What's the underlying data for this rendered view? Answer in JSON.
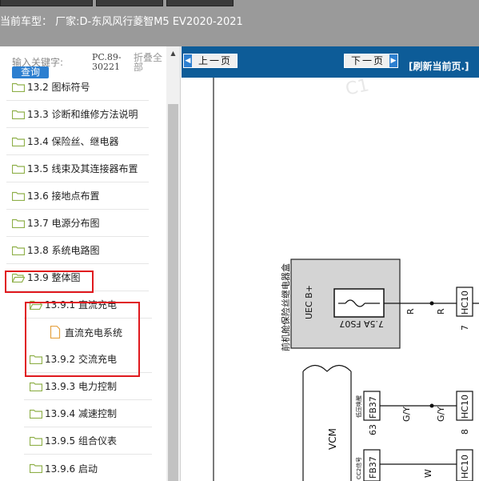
{
  "header": {
    "vehicle_label": "当前车型：  厂家:D-东风风行菱智M5 EV2020-2021"
  },
  "search": {
    "placeholder_label": "输入关键字:",
    "button_label": "查询",
    "pc_number": "PC.89-30221",
    "collapse_all": "折叠全部"
  },
  "tree": {
    "items": [
      {
        "label": "13.2 图标符号"
      },
      {
        "label": "13.3 诊断和维修方法说明"
      },
      {
        "label": "13.4 保险丝、继电器"
      },
      {
        "label": "13.5 线束及其连接器布置"
      },
      {
        "label": "13.6 接地点布置"
      },
      {
        "label": "13.7 电源分布图"
      },
      {
        "label": "13.8 系统电路图"
      },
      {
        "label": "13.9 整体图"
      },
      {
        "label": "13.9.1 直流充电"
      },
      {
        "label": "直流充电系统"
      },
      {
        "label": "13.9.2 交流充电"
      },
      {
        "label": "13.9.3 电力控制"
      },
      {
        "label": "13.9.4 减速控制"
      },
      {
        "label": "13.9.5 组合仪表"
      },
      {
        "label": "13.9.6 启动"
      }
    ]
  },
  "nav": {
    "prev_label": "上一页",
    "next_label": "下一页",
    "refresh_label": "[刷新当前页.]"
  },
  "diagram": {
    "box_title": "前机舱保险丝继电器盒",
    "uec_label": "UEC B+",
    "fuse_label": "7.5A FS07",
    "wire_r1": "R",
    "wire_r2": "R",
    "hc10_a": "HC10",
    "hc10_a_pin": "7",
    "vcm_label": "VCM",
    "fb37_a": "FB37",
    "fb37_a_pin": "63",
    "fb37_a_note": "低压唤醒",
    "wire_gy1": "G/Y",
    "wire_gy2": "G/Y",
    "hc10_b": "HC10",
    "hc10_b_pin": "8",
    "fb37_b": "FB37",
    "fb37_b_note": "CC2信号",
    "wire_w": "W",
    "hc10_c": "HC10",
    "watermark": "C1"
  }
}
